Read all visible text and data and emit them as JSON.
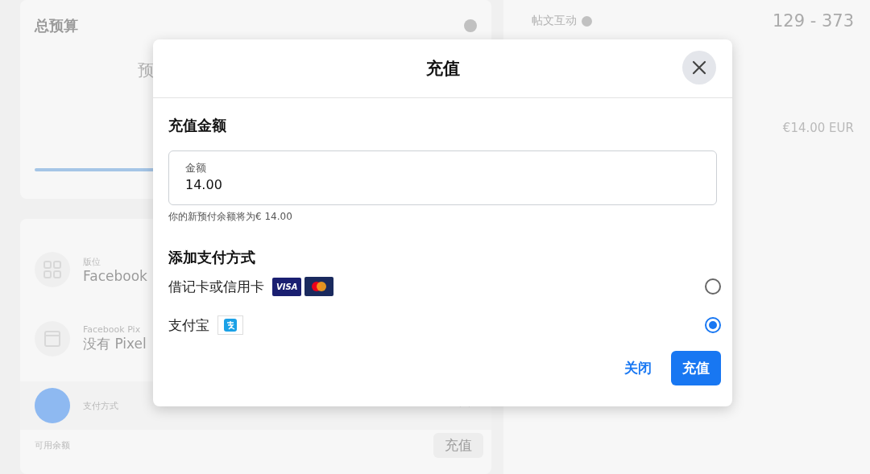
{
  "background": {
    "budget_card": {
      "title": "总预算",
      "partial_text": "预",
      "progress": {
        "level": 1
      }
    },
    "placement_card": {
      "items": [
        {
          "kind": "placement",
          "label": "版位",
          "value": "Facebook"
        },
        {
          "kind": "pixel",
          "label": "Facebook Pix",
          "value": "没有 Pixel"
        }
      ],
      "payment": {
        "title": "支付方式",
        "expanded": true,
        "balance_label": "可用余额",
        "topup_button": "充值"
      }
    },
    "stats": {
      "engagement_label": "帖文互动",
      "engagement_range": "129 - 373",
      "amount": "€14.00 EUR"
    }
  },
  "dialog": {
    "title": "充值",
    "section_title": "充值金额",
    "amount_field": {
      "label": "金额",
      "value": "14.00"
    },
    "helper": "你的新预付余额将为€ 14.00",
    "payment_title": "添加支付方式",
    "payment_methods": [
      {
        "kind": "card",
        "label": "借记卡或信用卡",
        "badge": "VISA",
        "selected": false
      },
      {
        "kind": "alipay",
        "label": "支付宝",
        "selected": true
      }
    ],
    "buttons": [
      {
        "kind": "secondary",
        "label": "关闭"
      },
      {
        "kind": "primary",
        "label": "充值"
      }
    ]
  }
}
